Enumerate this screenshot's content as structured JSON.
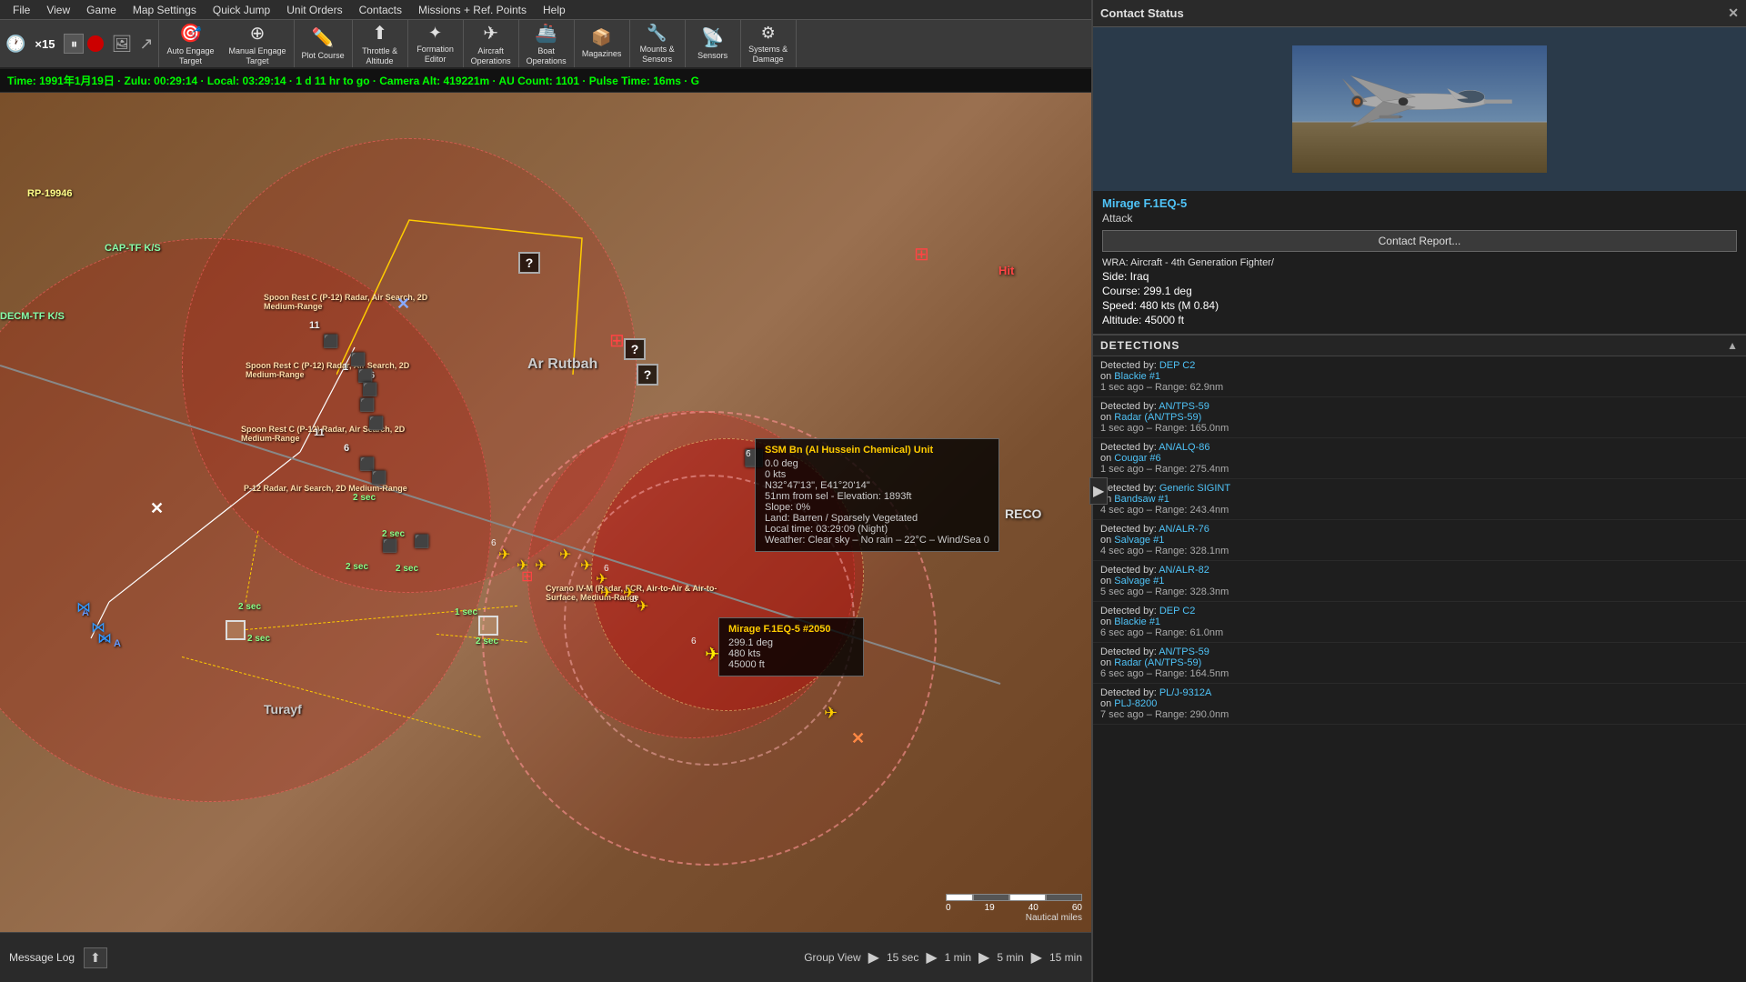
{
  "menu": {
    "items": [
      "File",
      "View",
      "Game",
      "Map Settings",
      "Quick Jump",
      "Unit Orders",
      "Contacts",
      "Missions + Ref. Points",
      "Help"
    ]
  },
  "toolbar": {
    "speed_display": "×15",
    "buttons": [
      {
        "id": "auto-engage",
        "icon": "🎯",
        "label": "Auto Engage\nTarget"
      },
      {
        "id": "manual-engage",
        "icon": "🎯",
        "label": "Manual Engage\nTarget"
      },
      {
        "id": "plot-course",
        "icon": "✏️",
        "label": "Plot Course"
      },
      {
        "id": "throttle",
        "icon": "⬆",
        "label": "Throttle &\nAltitude"
      },
      {
        "id": "formation",
        "icon": "✦",
        "label": "Formation\nEditor"
      },
      {
        "id": "aircraft-ops",
        "icon": "✈",
        "label": "Aircraft\nOperations"
      },
      {
        "id": "boat-ops",
        "icon": "🚢",
        "label": "Boat\nOperations"
      },
      {
        "id": "magazines",
        "icon": "📦",
        "label": "Magazines"
      },
      {
        "id": "mounts",
        "icon": "🔧",
        "label": "Mounts &\nSensors"
      },
      {
        "id": "sensors",
        "icon": "📡",
        "label": "Sensors"
      },
      {
        "id": "sys-damage",
        "icon": "⚙",
        "label": "Systems &\nDamage"
      }
    ]
  },
  "status_bar": {
    "text": "Time: 1991年1月19日 · Zulu: 00:29:14 · Local: 03:29:14 · 1 d 11 hr to go · Camera Alt: 419221m  · AU Count: 1101 · Pulse Time: 16ms · G"
  },
  "contact_status": {
    "header": "Contact Status",
    "unit_name": "Mirage F.1EQ-5 #2050",
    "unit_link": "Mirage F.1EQ-5",
    "role": "Attack",
    "contact_report_btn": "Contact Report...",
    "wra": "WRA: Aircraft - 4th Generation Fighter/",
    "side": "Side: Iraq",
    "course": "Course: 299.1 deg",
    "speed": "Speed: 480 kts (M 0.84)",
    "altitude": "Altitude: 45000 ft"
  },
  "detections_header": "DETECTIONS",
  "detections": [
    {
      "by": "DEP C2",
      "on": "Blackie #1",
      "time": "1 sec ago",
      "range": "Range: 62.9nm"
    },
    {
      "by": "AN/TPS-59",
      "on": "Radar (AN/TPS-59)",
      "time": "1 sec ago",
      "range": "Range: 165.0nm"
    },
    {
      "by": "AN/ALQ-86",
      "on": "Cougar #6",
      "time": "1 sec ago",
      "range": "Range: 275.4nm"
    },
    {
      "by": "Generic SIGINT",
      "on": "Bandsaw #1",
      "time": "4 sec ago",
      "range": "Range: 243.4nm"
    },
    {
      "by": "AN/ALR-76",
      "on": "Salvage #1",
      "time": "4 sec ago",
      "range": "Range: 328.1nm"
    },
    {
      "by": "AN/ALR-82",
      "on": "Salvage #1",
      "time": "5 sec ago",
      "range": "Range: 328.3nm"
    },
    {
      "by": "DEP C2",
      "on": "Blackie #1",
      "time": "6 sec ago",
      "range": "Range: 61.0nm"
    },
    {
      "by": "AN/TPS-59",
      "on": "Radar (AN/TPS-59)",
      "time": "6 sec ago",
      "range": "Range: 164.5nm"
    },
    {
      "by": "PL/J-9312A",
      "on": "PLJ-8200",
      "time": "7 sec ago",
      "range": "Range: 290.0nm"
    }
  ],
  "map": {
    "location_labels": [
      "Ar Rutbah",
      "Turayf"
    ],
    "unit_labels": [
      "RP-19946",
      "CAP-TF K/S",
      "DECM-TF K/S"
    ],
    "selected_unit": {
      "name": "SSM Bn (Al Hussein Chemical) Unit",
      "course": "0.0 deg",
      "speed": "0 kts",
      "coords": "N32°47'13\", E41°20'14\"",
      "dist": "51nm from sel",
      "elevation": "Elevation: 1893ft",
      "slope": "Slope: 0%",
      "terrain": "Land: Barren / Sparsely Vegetated",
      "local_time": "Local time: 03:29:09 (Night)",
      "weather": "Weather: Clear sky – No rain – 22°C – Wind/Sea 0"
    },
    "mirage_info": {
      "name": "Mirage F.1EQ-5 #2050",
      "course": "299.1 deg",
      "speed": "480 kts",
      "altitude": "45000 ft"
    }
  },
  "bottom_bar": {
    "message_log": "Message Log",
    "time_controls": [
      {
        "label": "Group View"
      },
      {
        "icon": "▶",
        "label": "15 sec"
      },
      {
        "icon": "▶",
        "label": "1 min"
      },
      {
        "icon": "▶",
        "label": "5 min"
      },
      {
        "icon": "▶",
        "label": "15 min"
      }
    ]
  },
  "scale_bar": {
    "values": [
      "0",
      "19",
      "40",
      "60"
    ],
    "unit": "Nautical miles"
  }
}
